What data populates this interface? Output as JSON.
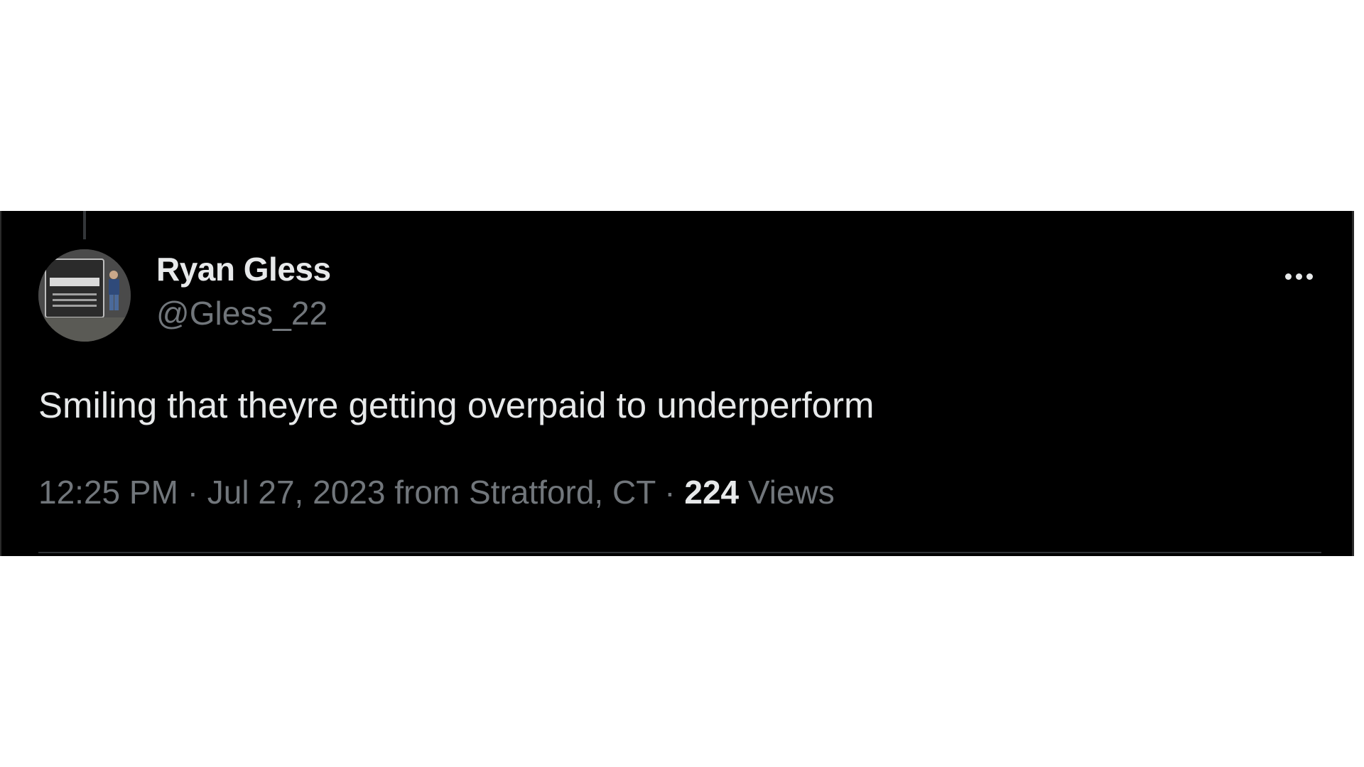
{
  "tweet": {
    "author": {
      "name": "Ryan Gless",
      "handle": "@Gless_22",
      "avatar_icon": "profile-photo"
    },
    "text": "Smiling that theyre getting overpaid to underperform",
    "meta": {
      "time": "12:25 PM",
      "separator": "·",
      "date": "Jul 27, 2023",
      "source": "from Stratford, CT",
      "views_count": "224",
      "views_label": "Views"
    },
    "more_icon": "more-horizontal-icon"
  },
  "colors": {
    "background": "#000000",
    "primary_text": "#e7e9ea",
    "secondary_text": "#71767b",
    "divider": "#2f3336"
  }
}
